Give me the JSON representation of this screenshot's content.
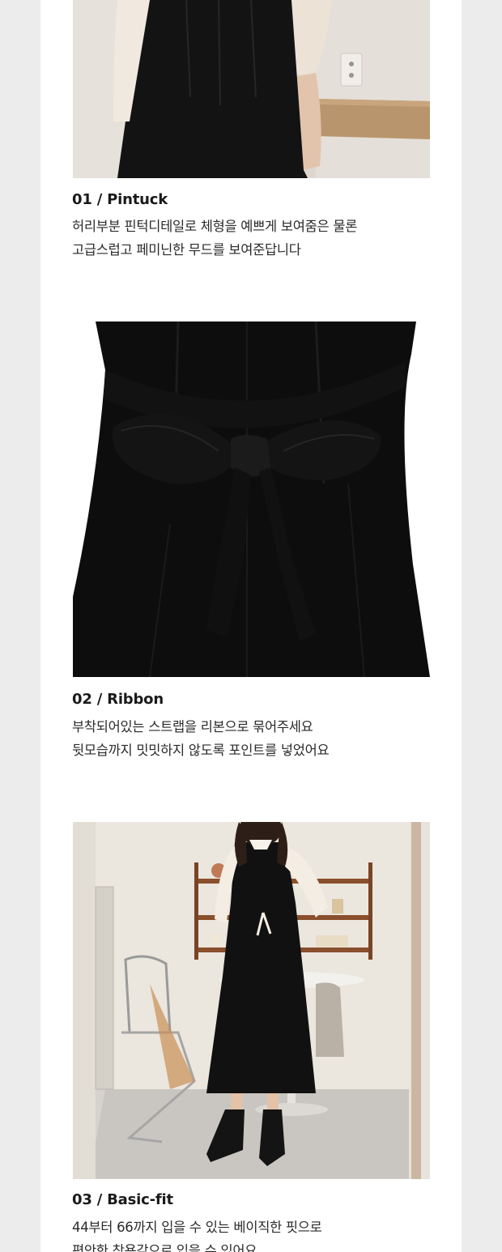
{
  "sections": [
    {
      "title": "01 / Pintuck",
      "lines": [
        "허리부분 핀턱디테일로 체형을 예쁘게 보여줌은 물론",
        "고급스럽고 페미닌한 무드를 보여준답니다"
      ],
      "photo_alt": "black dress waist pintuck detail with white puff sleeve"
    },
    {
      "title": "02 / Ribbon",
      "lines": [
        "부착되어있는 스트랩을 리본으로 묶어주세요",
        "뒷모습까지 밋밋하지 않도록 포인트를 넣었어요"
      ],
      "photo_alt": "black dress back with tied ribbon strap"
    },
    {
      "title": "03 / Basic-fit",
      "lines": [
        "44부터 66까지 입을 수 있는 베이직한 핏으로",
        "편안한 착용감으로 입을 수 있어요"
      ],
      "photo_alt": "model wearing black long dress in interior room"
    }
  ],
  "colors": {
    "background": "#ececec",
    "panel": "#ffffff",
    "dress": "#111111",
    "text": "#1a1a1a"
  }
}
